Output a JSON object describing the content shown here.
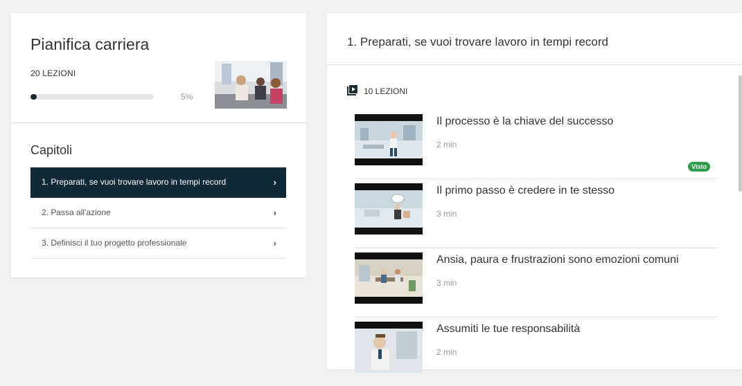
{
  "course": {
    "title": "Pianifica carriera",
    "lessons_label": "20 LEZIONI",
    "progress_percent": 5,
    "progress_label": "5%"
  },
  "chapters": {
    "title": "Capitoli",
    "items": [
      {
        "label": "1. Preparati, se vuoi trovare lavoro in tempi record",
        "active": true
      },
      {
        "label": "2. Passa all'azione",
        "active": false
      },
      {
        "label": "3. Definisci il tuo progetto professionale",
        "active": false
      }
    ],
    "chevron": "›"
  },
  "section": {
    "title": "1. Preparati, se vuoi trovare lavoro in tempi record",
    "lessons_label": "10 LEZIONI",
    "icon": "video-library-icon",
    "lessons": [
      {
        "title": "Il processo è la chiave del successo",
        "duration": "2 min",
        "badge": "Visto"
      },
      {
        "title": "Il primo passo è credere in te stesso",
        "duration": "3 min",
        "badge": ""
      },
      {
        "title": "Ansia, paura e frustrazioni sono emozioni comuni",
        "duration": "3 min",
        "badge": ""
      },
      {
        "title": "Assumiti le tue responsabilità",
        "duration": "2 min",
        "badge": ""
      }
    ]
  },
  "colors": {
    "active_chapter_bg": "#0f2a35",
    "progress_fill": "#1b2a31",
    "badge_green": "#2e9e4a"
  }
}
